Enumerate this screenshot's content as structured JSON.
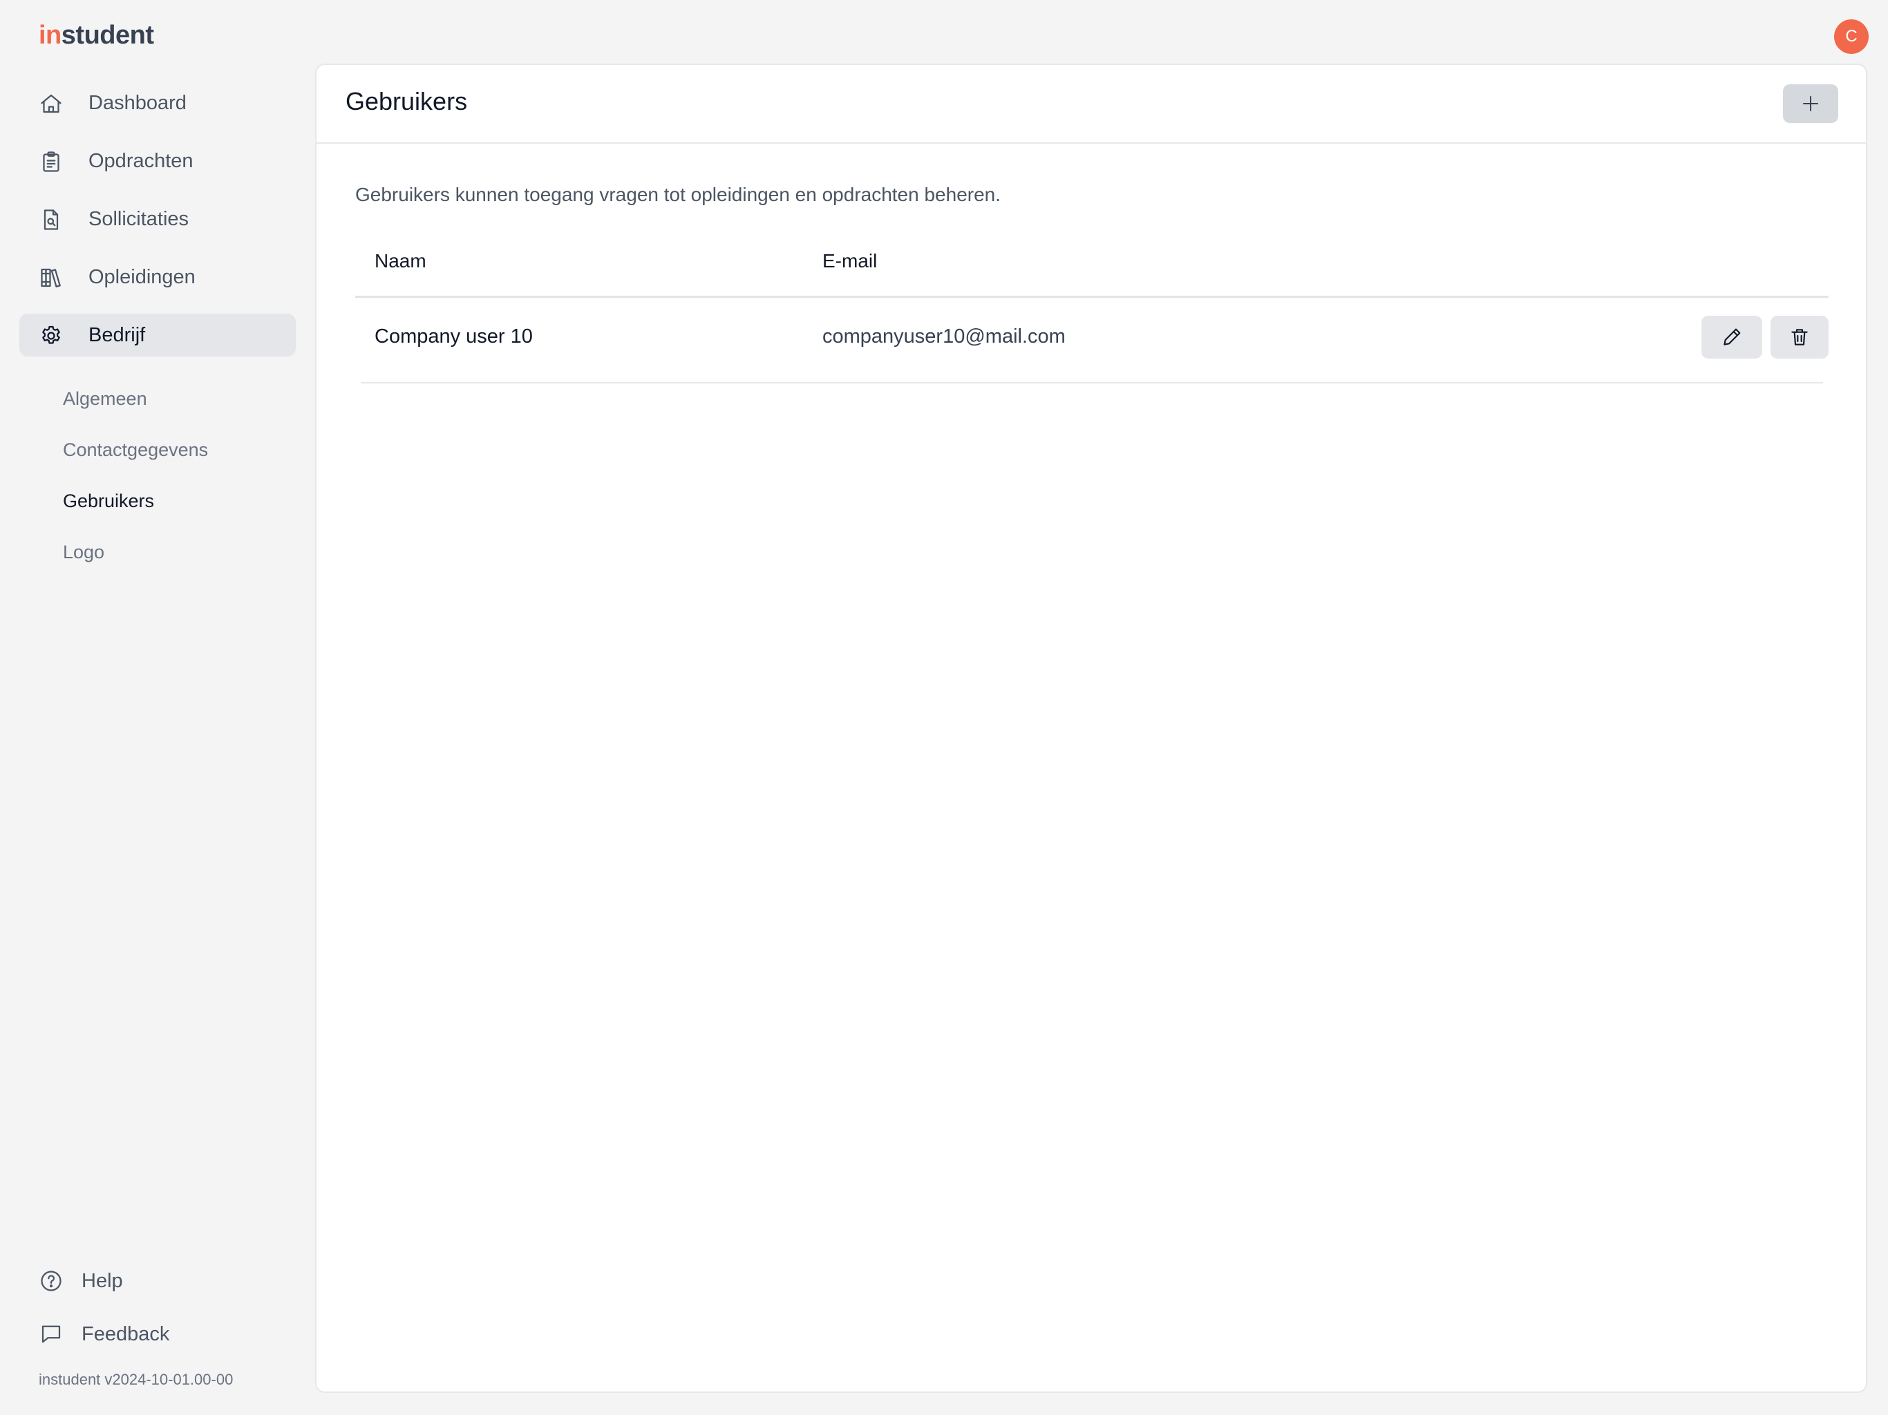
{
  "app": {
    "logo_prefix": "in",
    "logo_suffix": "student",
    "brand_color": "#f2684a",
    "version": "instudent v2024-10-01.00-00"
  },
  "user": {
    "avatar_initial": "C"
  },
  "sidebar": {
    "items": [
      {
        "label": "Dashboard",
        "icon": "home-icon"
      },
      {
        "label": "Opdrachten",
        "icon": "clipboard-icon"
      },
      {
        "label": "Sollicitaties",
        "icon": "document-search-icon"
      },
      {
        "label": "Opleidingen",
        "icon": "books-icon"
      },
      {
        "label": "Bedrijf",
        "icon": "gear-icon",
        "active": true
      }
    ],
    "sub_items": [
      {
        "label": "Algemeen"
      },
      {
        "label": "Contactgegevens"
      },
      {
        "label": "Gebruikers",
        "active": true
      },
      {
        "label": "Logo"
      }
    ],
    "bottom": {
      "help_label": "Help",
      "feedback_label": "Feedback"
    }
  },
  "main": {
    "title": "Gebruikers",
    "add_icon": "plus-icon",
    "description": "Gebruikers kunnen toegang vragen tot opleidingen en opdrachten beheren.",
    "table": {
      "columns": [
        "Naam",
        "E-mail"
      ],
      "rows": [
        {
          "name": "Company user 10",
          "email": "companyuser10@mail.com"
        }
      ]
    }
  }
}
